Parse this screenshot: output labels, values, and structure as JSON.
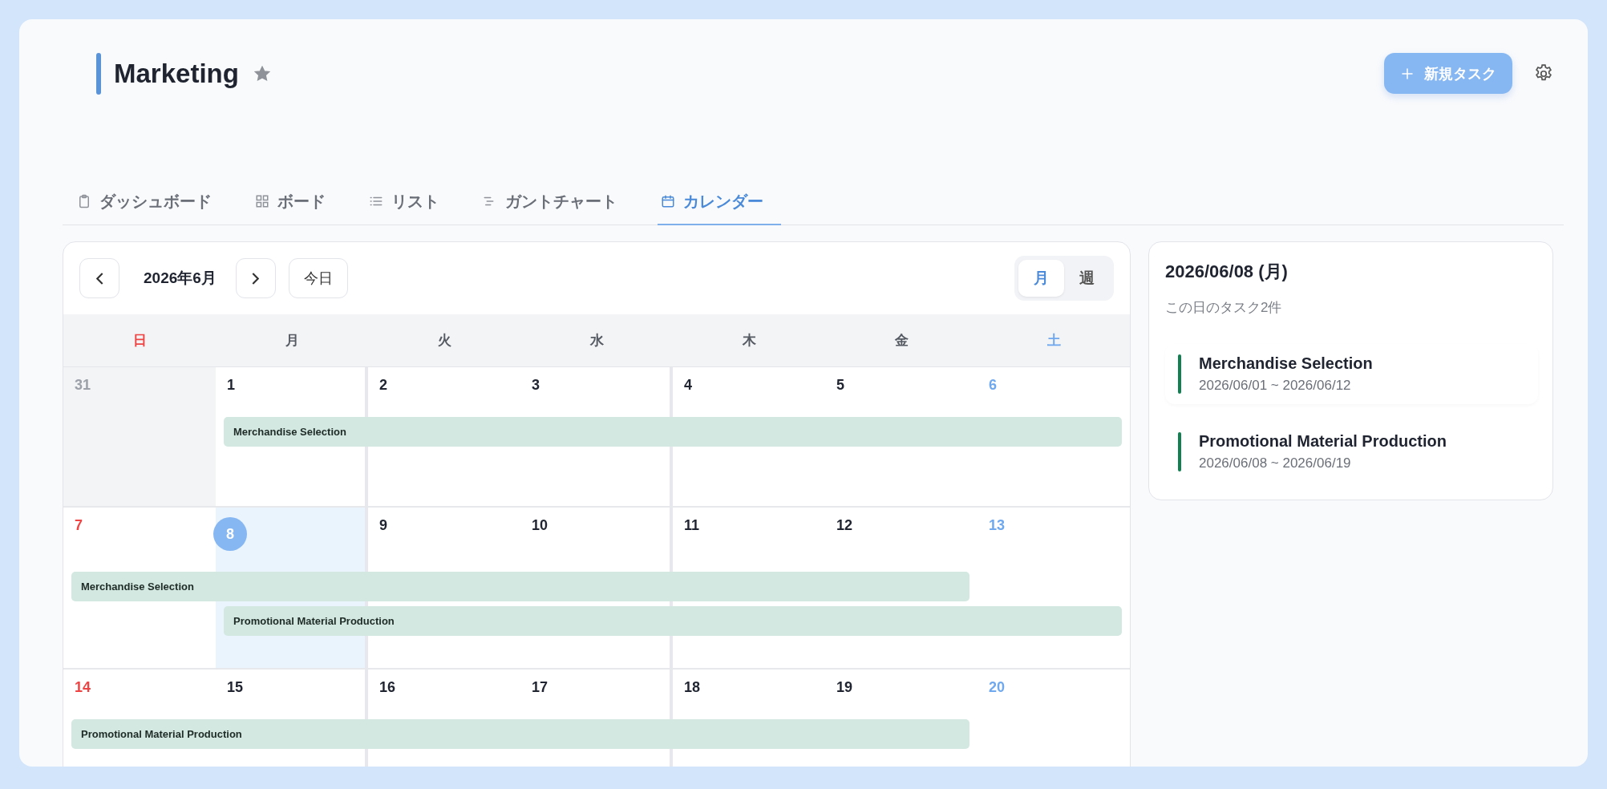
{
  "project": {
    "title": "Marketing",
    "starred": true
  },
  "new_task_button": {
    "label": "新規タスク"
  },
  "tabs": [
    {
      "label": "ダッシュボード",
      "kind": "dashboard",
      "selected": false
    },
    {
      "label": "ボード",
      "kind": "board",
      "selected": false
    },
    {
      "label": "リスト",
      "kind": "list",
      "selected": false
    },
    {
      "label": "ガントチャート",
      "kind": "gantt",
      "selected": false
    },
    {
      "label": "カレンダー",
      "kind": "calendar",
      "selected": true
    }
  ],
  "calendar": {
    "month_label": "2026年6月",
    "today_label": "今日",
    "views": [
      {
        "label": "月",
        "selected": true
      },
      {
        "label": "週",
        "selected": false
      }
    ],
    "weekdays": [
      {
        "label": "日",
        "kind": "sunday"
      },
      {
        "label": "月",
        "kind": "weekday"
      },
      {
        "label": "火",
        "kind": "weekday"
      },
      {
        "label": "水",
        "kind": "weekday"
      },
      {
        "label": "木",
        "kind": "weekday"
      },
      {
        "label": "金",
        "kind": "weekday"
      },
      {
        "label": "土",
        "kind": "saturday"
      }
    ],
    "weeks": [
      {
        "days": [
          {
            "label": "31",
            "muted": true,
            "selected": false
          },
          {
            "label": "1",
            "muted": false,
            "selected": false
          },
          {
            "label": "2",
            "muted": false,
            "selected": false
          },
          {
            "label": "3",
            "muted": false,
            "selected": false
          },
          {
            "label": "4",
            "muted": false,
            "selected": false
          },
          {
            "label": "5",
            "muted": false,
            "selected": false
          },
          {
            "label": "6",
            "muted": false,
            "selected": false
          }
        ],
        "events": [
          {
            "title": "Merchandise Selection",
            "days": [
              {
                "kind": "empty"
              },
              {
                "kind": "bar"
              },
              {
                "kind": "bar"
              },
              {
                "kind": "bar"
              },
              {
                "kind": "bar"
              },
              {
                "kind": "bar"
              },
              {
                "kind": "bar"
              }
            ]
          }
        ]
      },
      {
        "days": [
          {
            "label": "7",
            "muted": false,
            "selected": false
          },
          {
            "label": "8",
            "muted": false,
            "selected": true
          },
          {
            "label": "9",
            "muted": false,
            "selected": false
          },
          {
            "label": "10",
            "muted": false,
            "selected": false
          },
          {
            "label": "11",
            "muted": false,
            "selected": false
          },
          {
            "label": "12",
            "muted": false,
            "selected": false
          },
          {
            "label": "13",
            "muted": false,
            "selected": false
          }
        ],
        "events": [
          {
            "title": "Merchandise Selection",
            "days": [
              {
                "kind": "bar"
              },
              {
                "kind": "bar"
              },
              {
                "kind": "bar"
              },
              {
                "kind": "bar"
              },
              {
                "kind": "bar"
              },
              {
                "kind": "bar"
              },
              {
                "kind": "empty"
              }
            ]
          },
          {
            "title": "Promotional Material Production",
            "days": [
              {
                "kind": "empty"
              },
              {
                "kind": "bar"
              },
              {
                "kind": "bar"
              },
              {
                "kind": "bar"
              },
              {
                "kind": "bar"
              },
              {
                "kind": "bar"
              },
              {
                "kind": "bar"
              }
            ]
          }
        ]
      },
      {
        "days": [
          {
            "label": "14",
            "muted": false,
            "selected": false
          },
          {
            "label": "15",
            "muted": false,
            "selected": false
          },
          {
            "label": "16",
            "muted": false,
            "selected": false
          },
          {
            "label": "17",
            "muted": false,
            "selected": false
          },
          {
            "label": "18",
            "muted": false,
            "selected": false
          },
          {
            "label": "19",
            "muted": false,
            "selected": false
          },
          {
            "label": "20",
            "muted": false,
            "selected": false
          }
        ],
        "events": [
          {
            "title": "Promotional Material Production",
            "days": [
              {
                "kind": "bar"
              },
              {
                "kind": "bar"
              },
              {
                "kind": "bar"
              },
              {
                "kind": "bar"
              },
              {
                "kind": "bar"
              },
              {
                "kind": "bar"
              },
              {
                "kind": "empty"
              }
            ]
          }
        ]
      }
    ]
  },
  "day_panel": {
    "date": "2026/06/08 (月)",
    "summary": "この日のタスク2件",
    "tasks": [
      {
        "title": "Merchandise Selection",
        "dates": "2026/06/01 ~ 2026/06/12"
      },
      {
        "title": "Promotional Material Production",
        "dates": "2026/06/08 ~ 2026/06/19"
      }
    ]
  }
}
